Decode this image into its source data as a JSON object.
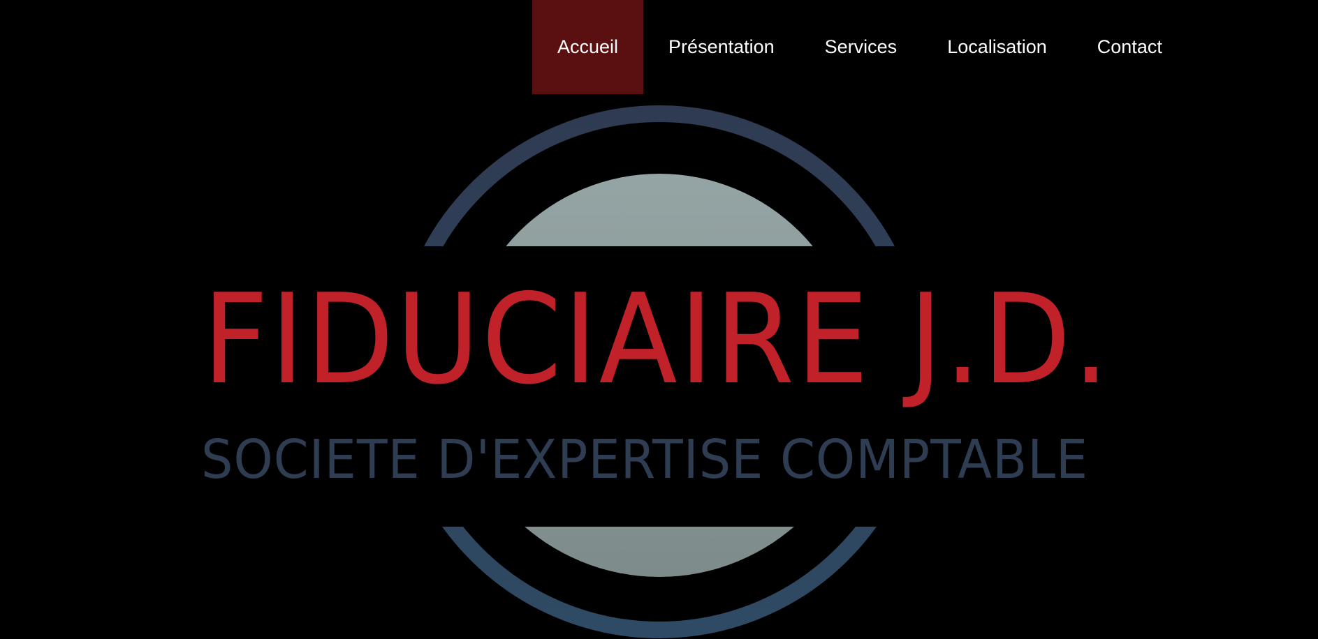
{
  "nav": {
    "items": [
      {
        "label": "Accueil",
        "active": true
      },
      {
        "label": "Présentation",
        "active": false
      },
      {
        "label": "Services",
        "active": false
      },
      {
        "label": "Localisation",
        "active": false
      },
      {
        "label": "Contact",
        "active": false
      }
    ],
    "active_color": "#5a0f10",
    "text_color": "#ffffff"
  },
  "logo": {
    "title": "FIDUCIAIRE J.D.",
    "subtitle": "SOCIETE D'EXPERTISE COMPTABLE",
    "title_color": "#c1222a",
    "subtitle_color": "#2f3d52",
    "ring_color": "#2f4058",
    "disc_color": "#93a2a2"
  },
  "background_color": "#000000"
}
